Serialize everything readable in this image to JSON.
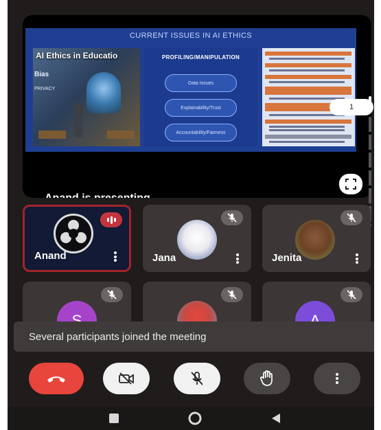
{
  "slide": {
    "title": "CURRENT ISSUES IN AI ETHICS",
    "image_title": "AI Ethics in Educatio",
    "image_word_bias": "Bias",
    "image_word_privacy": "PRIVACY",
    "center_heading": "PROFILING/MANIPULATION",
    "pills": [
      "Data Issues",
      "Explainability/Trust",
      "Accountability/Fairness"
    ],
    "right_items": [
      {
        "heading": "AI needs data",
        "bullet": "Data privacy and governance"
      },
      {
        "heading": "AI is often a black box",
        "bullet": "Explainability and transparency"
      },
      {
        "heading": "AI can make or recommend decisions",
        "bullet": "Fairness and value alignment"
      },
      {
        "heading": "AI is based on statistics and always has a small percentage of error",
        "bullet": "Accountability"
      },
      {
        "heading": "AI can profile people and manipulate their preferences",
        "bullet": "Human and moral agency"
      },
      {
        "heading": "AI is very pervasive and dynamic",
        "bullet": "Larger negative impacts for tech misuse"
      },
      {
        "heading": "Good or bad use of the technology",
        "bullet": "Autonomous weapons"
      }
    ]
  },
  "presenting_text": "Anand is presenting",
  "page_indicator": "1",
  "participants": [
    {
      "name": "Anand",
      "state": "speaking"
    },
    {
      "name": "Jana",
      "state": "muted"
    },
    {
      "name": "Jenita",
      "state": "muted"
    },
    {
      "name": "",
      "initial": "S",
      "state": "muted",
      "color": "#a544c9"
    },
    {
      "name": "",
      "state": "muted"
    },
    {
      "name": "",
      "initial": "A",
      "state": "muted",
      "color": "#7c4dd9"
    }
  ],
  "toast": "Several participants joined the meeting",
  "controls": [
    "end-call",
    "camera-off",
    "mic-off",
    "raise-hand",
    "more-options"
  ],
  "colors": {
    "end_call": "#e8453c",
    "background": "#201c1c",
    "speaking": "#c4343d"
  }
}
